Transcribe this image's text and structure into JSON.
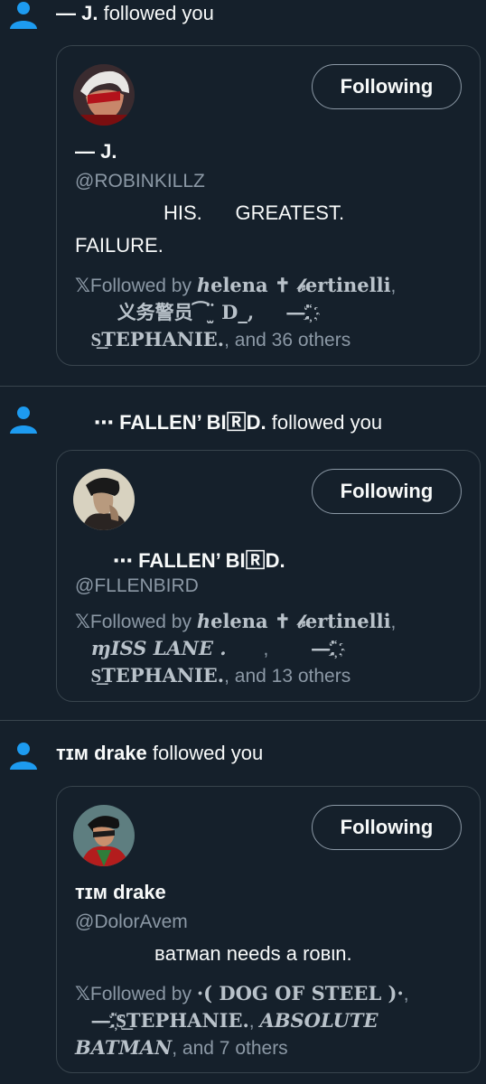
{
  "notifications": [
    {
      "notif_name": "— J.",
      "notif_suffix": " followed you",
      "display_name": "— J.",
      "handle": "@ROBINKILLZ",
      "bio_line1": "HIS.      GREATEST.",
      "bio_line2": "FAILURE.",
      "button_label": "Following",
      "followed_prefix": "Followed by ",
      "followers_1": "ℎelena ✝ 𝒷ertinelli",
      "followers_2": "义务警员⁀ ̫̈ D_,",
      "followers_3": "—⁚҉",
      "followers_4": "S͟TEPHANIE.",
      "followed_suffix": ", and 36 others"
    },
    {
      "notif_name": "⋯ FALLEN’ BI🅁D.",
      "notif_suffix": " followed you",
      "display_name": "⋯ FALLEN’ BI🅁D.",
      "handle": "@FLLENBIRD",
      "button_label": "Following",
      "followed_prefix": "Followed by ",
      "followers_1": "ℎelena ✝ 𝒷ertinelli",
      "followers_2": "ɱISS LANE .",
      "followers_3": "—⁚҉",
      "followers_4": "S͟TEPHANIE.",
      "followed_suffix": ", and 13 others"
    },
    {
      "notif_name": "ᴛɪᴍ drake",
      "notif_suffix": " followed you",
      "display_name": "ᴛɪᴍ drake",
      "handle": "@DolorAvem",
      "bio_line1": "вaтмan needs a roвιn.",
      "button_label": "Following",
      "followed_prefix": "Followed by ",
      "followers_1": "·( DOG OF STEEL )·",
      "followers_2": "—⁚҉",
      "followers_3": "S͟TEPHANIE.",
      "followers_4": "ABSOLUTE BATMAN",
      "followed_suffix": ", and 7 others"
    }
  ],
  "icons": {
    "person": "person-icon",
    "x_logo": "𝕏"
  },
  "colors": {
    "background": "#15202b",
    "accent": "#1d9bf0",
    "secondary_text": "#8b98a5",
    "border": "#38444d"
  }
}
